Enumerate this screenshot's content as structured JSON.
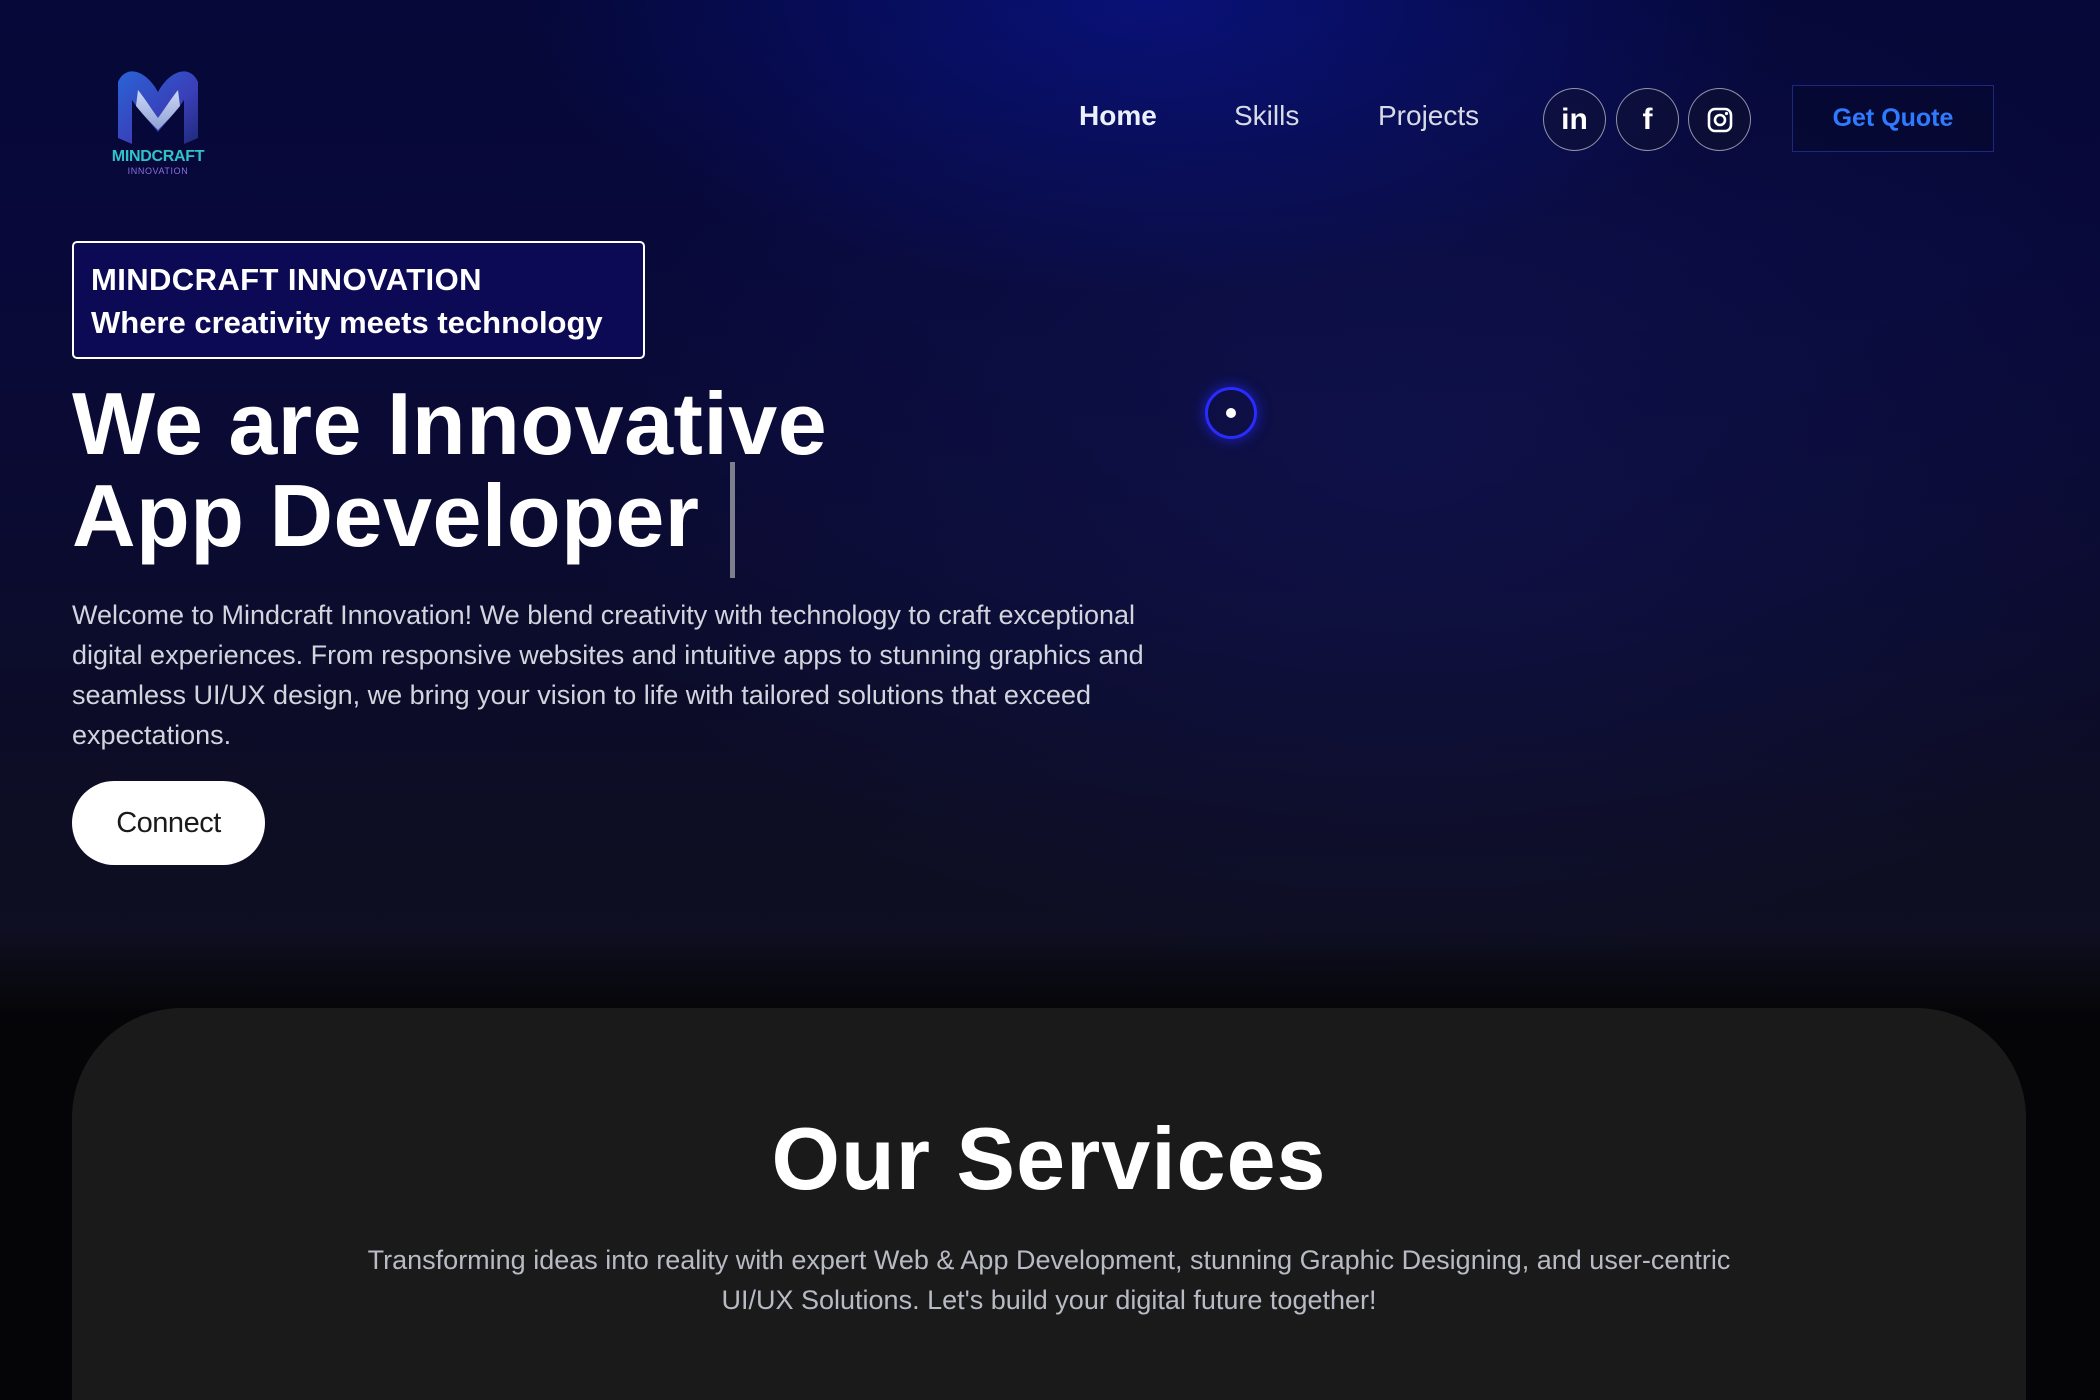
{
  "brand": {
    "logo_text": "MINDCRAFT",
    "logo_subtext": "INNOVATION"
  },
  "nav": {
    "items": [
      {
        "label": "Home",
        "active": true
      },
      {
        "label": "Skills",
        "active": false
      },
      {
        "label": "Projects",
        "active": false
      }
    ],
    "social": [
      {
        "icon": "linkedin-icon",
        "glyph": "in"
      },
      {
        "icon": "facebook-icon",
        "glyph": "f"
      },
      {
        "icon": "instagram-icon",
        "glyph": ""
      }
    ],
    "cta_label": "Get Quote"
  },
  "hero": {
    "tagline_line1": "MINDCRAFT INNOVATION",
    "tagline_line2": "Where creativity meets technology",
    "headline_line1": "We are Innovative",
    "headline_line2": "App Developer",
    "intro": "Welcome to Mindcraft Innovation! We blend creativity with technology to craft exceptional digital experiences. From responsive websites and intuitive apps to stunning graphics and seamless UI/UX design, we bring your vision to life with tailored solutions that exceed expectations.",
    "connect_label": "Connect"
  },
  "services": {
    "title": "Our Services",
    "description": "Transforming ideas into reality with expert Web & App Development, stunning Graphic Designing, and user-centric UI/UX Solutions. Let's build your digital future together!"
  },
  "colors": {
    "accent_blue": "#2f7bff",
    "hero_bg": "#08093a",
    "tagline_bg": "#0d0a55",
    "panel_bg": "#1a1a1b"
  }
}
